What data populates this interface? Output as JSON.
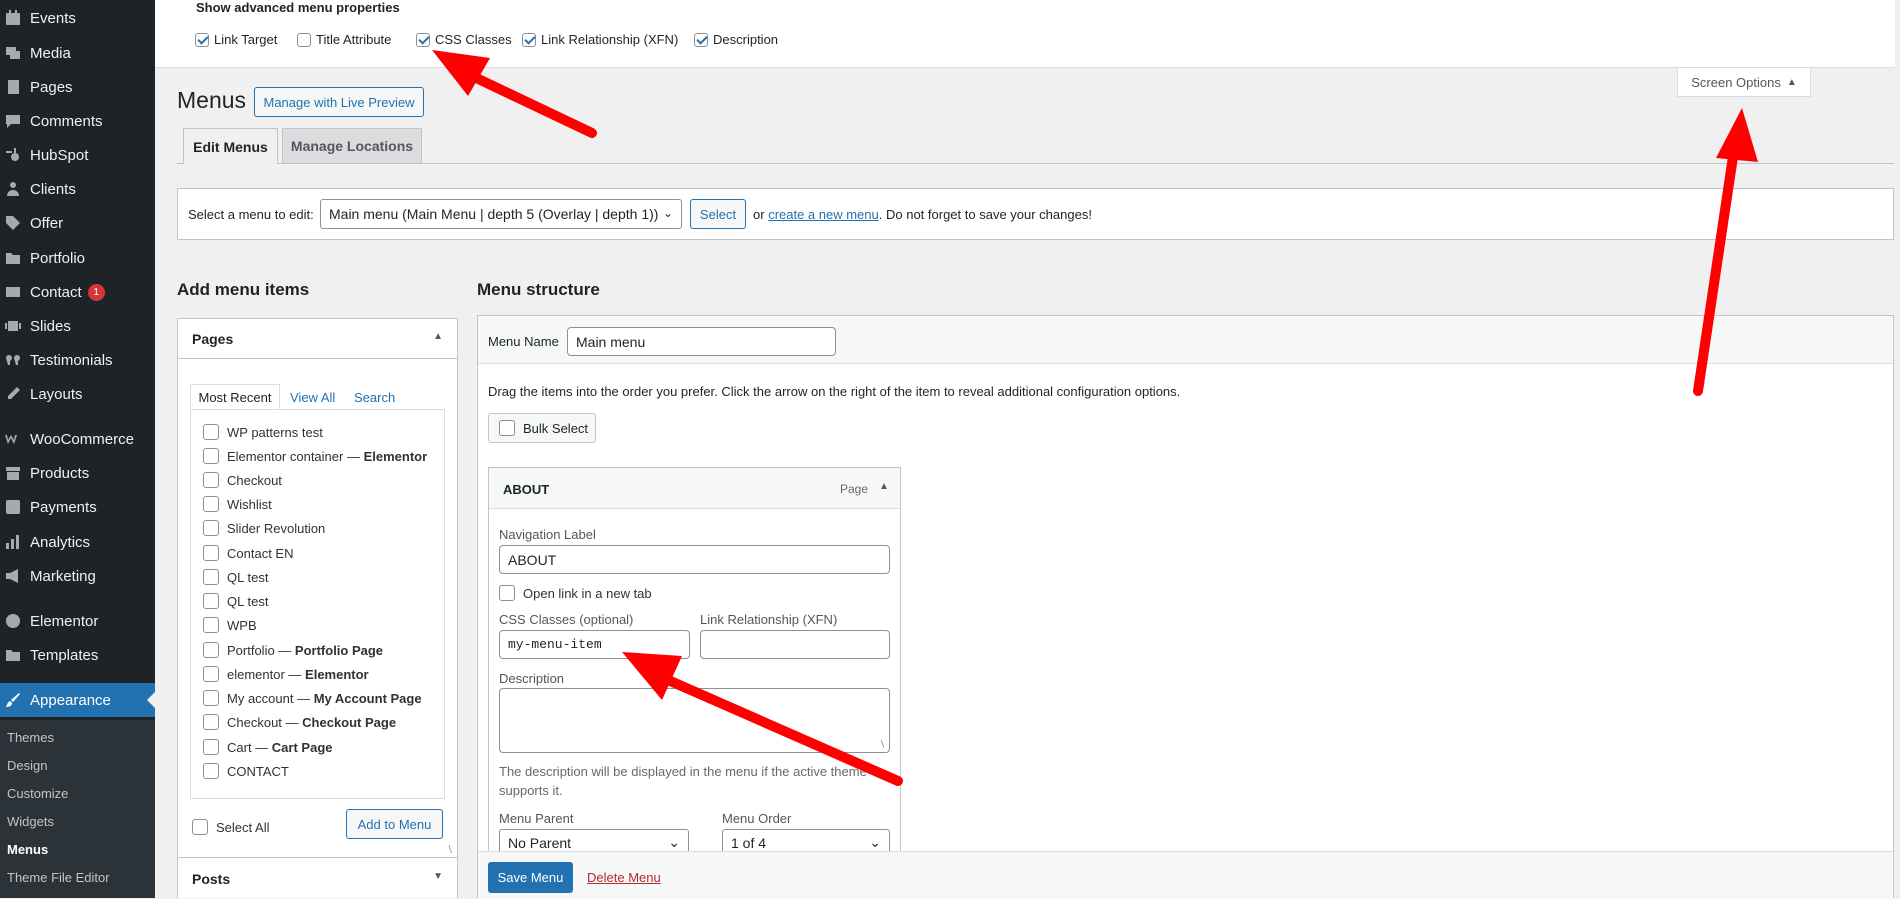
{
  "sidebar": {
    "items": [
      {
        "label": "Events",
        "icon": "calendar-icon"
      },
      {
        "label": "Media",
        "icon": "media-icon"
      },
      {
        "label": "Pages",
        "icon": "pages-icon"
      },
      {
        "label": "Comments",
        "icon": "comments-icon"
      },
      {
        "label": "HubSpot",
        "icon": "hubspot-icon"
      },
      {
        "label": "Clients",
        "icon": "clients-icon"
      },
      {
        "label": "Offer",
        "icon": "offer-icon"
      },
      {
        "label": "Portfolio",
        "icon": "portfolio-icon"
      },
      {
        "label": "Contact",
        "icon": "mail-icon",
        "badge": "1"
      },
      {
        "label": "Slides",
        "icon": "slides-icon"
      },
      {
        "label": "Testimonials",
        "icon": "quote-icon"
      },
      {
        "label": "Layouts",
        "icon": "layouts-icon"
      },
      {
        "label": "WooCommerce",
        "icon": "woocommerce-icon"
      },
      {
        "label": "Products",
        "icon": "products-icon"
      },
      {
        "label": "Payments",
        "icon": "payments-icon"
      },
      {
        "label": "Analytics",
        "icon": "analytics-icon"
      },
      {
        "label": "Marketing",
        "icon": "marketing-icon"
      },
      {
        "label": "Elementor",
        "icon": "elementor-icon"
      },
      {
        "label": "Templates",
        "icon": "templates-icon"
      },
      {
        "label": "Appearance",
        "icon": "appearance-icon"
      }
    ],
    "submenu": [
      "Themes",
      "Design",
      "Customize",
      "Widgets",
      "Menus",
      "Theme File Editor"
    ],
    "accent": "#2271b1"
  },
  "screen_options": {
    "title": "Show advanced menu properties",
    "options": [
      {
        "label": "Link Target",
        "checked": true
      },
      {
        "label": "Title Attribute",
        "checked": false
      },
      {
        "label": "CSS Classes",
        "checked": true
      },
      {
        "label": "Link Relationship (XFN)",
        "checked": true
      },
      {
        "label": "Description",
        "checked": true
      }
    ],
    "tab_label": "Screen Options"
  },
  "header": {
    "title": "Menus",
    "live_preview": "Manage with Live Preview",
    "tabs": [
      "Edit Menus",
      "Manage Locations"
    ]
  },
  "select_bar": {
    "label": "Select a menu to edit:",
    "selected": "Main menu (Main Menu | depth 5 (Overlay | depth 1))",
    "select_button": "Select",
    "or_text": "or",
    "create_link": "create a new menu",
    "suffix": ". Do not forget to save your changes!"
  },
  "add_items": {
    "heading": "Add menu items",
    "pages_title": "Pages",
    "tabs": [
      "Most Recent",
      "View All",
      "Search"
    ],
    "pages": [
      {
        "name": "WP patterns test",
        "suffix": ""
      },
      {
        "name": "Elementor container — ",
        "suffix": "Elementor"
      },
      {
        "name": "Checkout",
        "suffix": ""
      },
      {
        "name": "Wishlist",
        "suffix": ""
      },
      {
        "name": "Slider Revolution",
        "suffix": ""
      },
      {
        "name": "Contact EN",
        "suffix": ""
      },
      {
        "name": "QL test",
        "suffix": ""
      },
      {
        "name": "QL test",
        "suffix": ""
      },
      {
        "name": "WPB",
        "suffix": ""
      },
      {
        "name": "Portfolio — ",
        "suffix": "Portfolio Page"
      },
      {
        "name": "elementor — ",
        "suffix": "Elementor"
      },
      {
        "name": "My account — ",
        "suffix": "My Account Page"
      },
      {
        "name": "Checkout — ",
        "suffix": "Checkout Page"
      },
      {
        "name": "Cart — ",
        "suffix": "Cart Page"
      },
      {
        "name": "CONTACT",
        "suffix": ""
      }
    ],
    "select_all": "Select All",
    "add_button": "Add to Menu",
    "posts_title": "Posts"
  },
  "structure": {
    "heading": "Menu structure",
    "name_label": "Menu Name",
    "name_value": "Main menu",
    "instructions": "Drag the items into the order you prefer. Click the arrow on the right of the item to reveal additional configuration options.",
    "bulk_select": "Bulk Select",
    "item": {
      "title": "ABOUT",
      "type": "Page",
      "nav_label_title": "Navigation Label",
      "nav_label_value": "ABOUT",
      "new_tab": "Open link in a new tab",
      "css_label": "CSS Classes (optional)",
      "css_value": "my-menu-item",
      "xfn_label": "Link Relationship (XFN)",
      "xfn_value": "",
      "desc_label": "Description",
      "desc_note_1": "The description will be displayed in the menu if the active theme",
      "desc_note_2": "supports it.",
      "parent_label": "Menu Parent",
      "parent_value": "No Parent",
      "order_label": "Menu Order",
      "order_value": "1 of 4"
    },
    "save_button": "Save Menu",
    "delete_link": "Delete Menu"
  },
  "colors": {
    "arrow": "#ff0000",
    "link": "#2271b1",
    "delete": "#b32d2e"
  }
}
